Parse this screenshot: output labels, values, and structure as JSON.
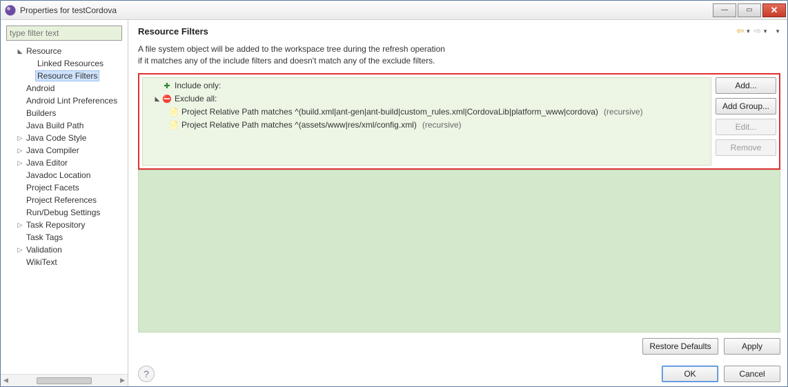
{
  "window": {
    "title": "Properties for testCordova"
  },
  "filter": {
    "placeholder": "type filter text"
  },
  "tree": {
    "items": [
      {
        "label": "Resource",
        "level": 1,
        "expander": "open"
      },
      {
        "label": "Linked Resources",
        "level": 2
      },
      {
        "label": "Resource Filters",
        "level": 2,
        "selected": true
      },
      {
        "label": "Android",
        "level": 1
      },
      {
        "label": "Android Lint Preferences",
        "level": 1
      },
      {
        "label": "Builders",
        "level": 1
      },
      {
        "label": "Java Build Path",
        "level": 1
      },
      {
        "label": "Java Code Style",
        "level": 1,
        "expander": "closed"
      },
      {
        "label": "Java Compiler",
        "level": 1,
        "expander": "closed"
      },
      {
        "label": "Java Editor",
        "level": 1,
        "expander": "closed"
      },
      {
        "label": "Javadoc Location",
        "level": 1
      },
      {
        "label": "Project Facets",
        "level": 1
      },
      {
        "label": "Project References",
        "level": 1
      },
      {
        "label": "Run/Debug Settings",
        "level": 1
      },
      {
        "label": "Task Repository",
        "level": 1,
        "expander": "closed"
      },
      {
        "label": "Task Tags",
        "level": 1
      },
      {
        "label": "Validation",
        "level": 1,
        "expander": "closed"
      },
      {
        "label": "WikiText",
        "level": 1
      }
    ]
  },
  "page": {
    "heading": "Resource Filters",
    "desc1": "A file system object will be added to the workspace tree during the refresh operation",
    "desc2": "if it matches any of the include filters and doesn't match any of the exclude filters."
  },
  "filters": {
    "include_label": "Include only:",
    "exclude_label": "Exclude all:",
    "rule1": "Project Relative Path matches ^(build.xml|ant-gen|ant-build|custom_rules.xml|CordovaLib|platform_www|cordova)",
    "rule1_suffix": "(recursive)",
    "rule2": "Project Relative Path matches ^(assets/www|res/xml/config.xml)",
    "rule2_suffix": "(recursive)"
  },
  "buttons": {
    "add": "Add...",
    "add_group": "Add Group...",
    "edit": "Edit...",
    "remove": "Remove",
    "restore": "Restore Defaults",
    "apply": "Apply",
    "ok": "OK",
    "cancel": "Cancel"
  }
}
